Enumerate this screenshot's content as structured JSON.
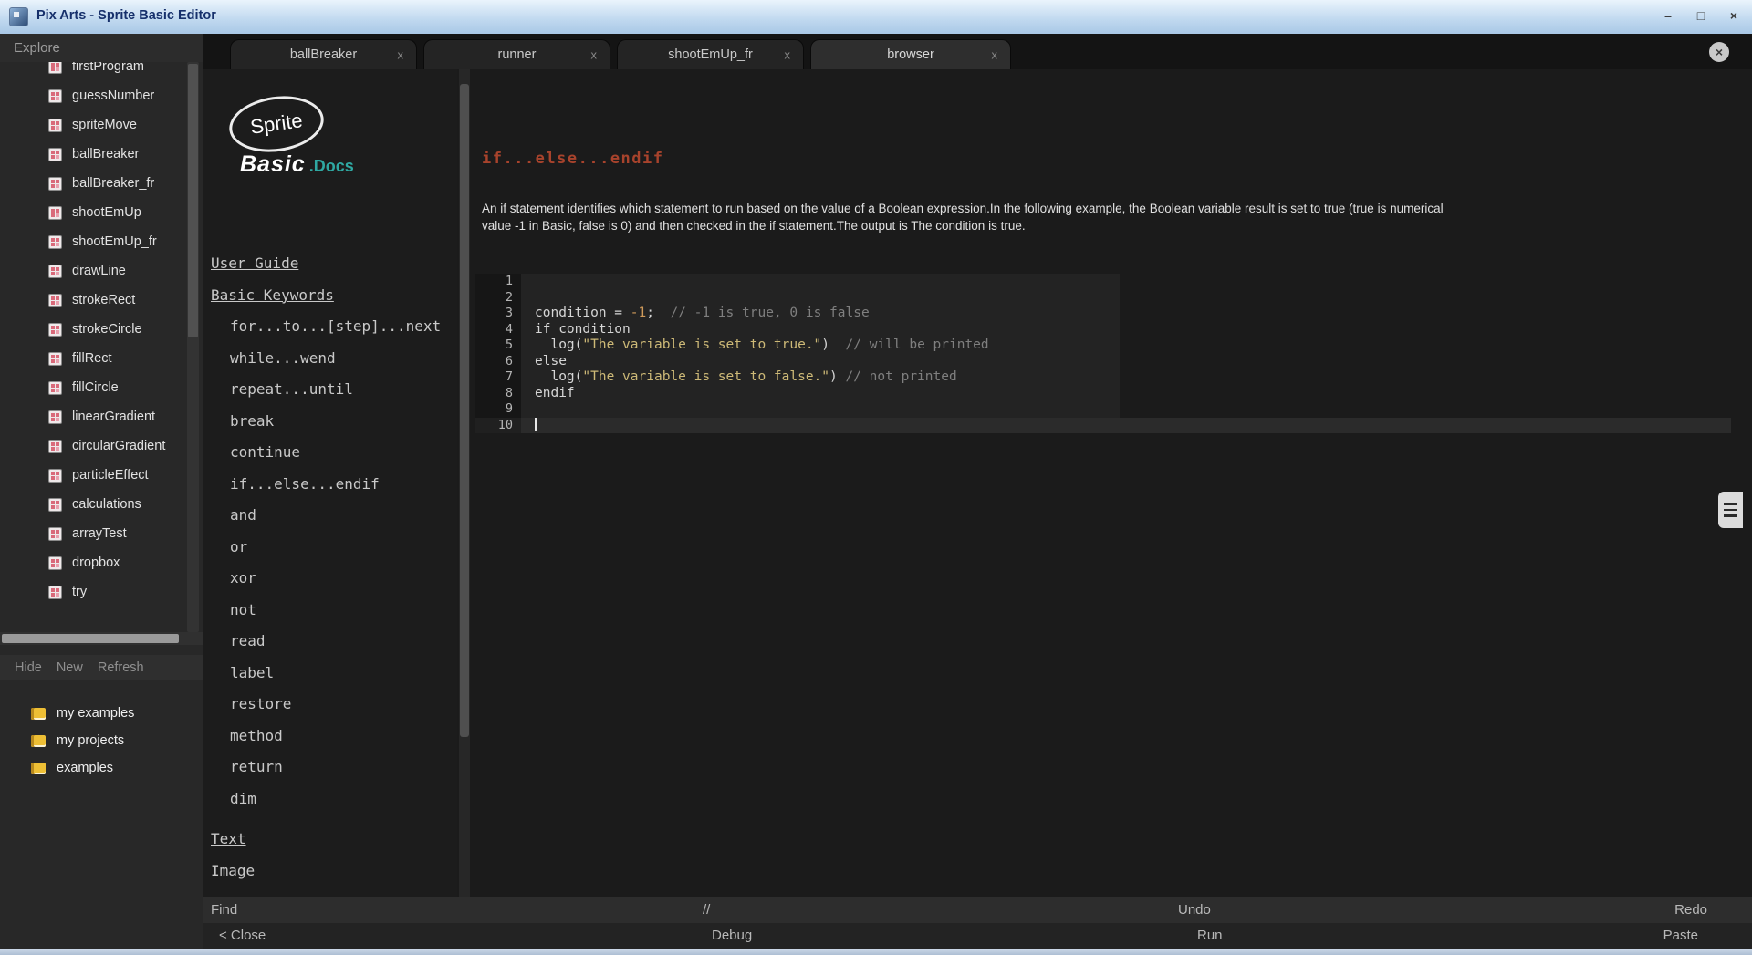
{
  "colors": {
    "accent_teal": "#2fa8a2",
    "doc_title_red": "#a8432c",
    "code_string": "#cdb977",
    "code_number": "#cf9a5a",
    "code_comment": "#7f7f7f",
    "titlebar_text": "#16306b"
  },
  "window": {
    "title": "Pix Arts - Sprite Basic Editor",
    "controls": [
      {
        "name": "minimize",
        "glyph": "–"
      },
      {
        "name": "maximize",
        "glyph": "□"
      },
      {
        "name": "close",
        "glyph": "×"
      }
    ]
  },
  "explorer": {
    "header": "Explore",
    "files": [
      "firstProgram",
      "guessNumber",
      "spriteMove",
      "ballBreaker",
      "ballBreaker_fr",
      "shootEmUp",
      "shootEmUp_fr",
      "drawLine",
      "strokeRect",
      "strokeCircle",
      "fillRect",
      "fillCircle",
      "linearGradient",
      "circularGradient",
      "particleEffect",
      "calculations",
      "arrayTest",
      "dropbox",
      "try"
    ],
    "actions": [
      "Hide",
      "New",
      "Refresh"
    ],
    "folders": [
      "my examples",
      "my projects",
      "examples"
    ]
  },
  "tabs_meta": {
    "close_glyph": "x",
    "close_all_glyph": "×"
  },
  "tabs": [
    {
      "label": "ballBreaker",
      "active": false
    },
    {
      "label": "runner",
      "active": false
    },
    {
      "label": "shootEmUp_fr",
      "active": false
    },
    {
      "label": "browser",
      "active": true
    }
  ],
  "docs_nav": {
    "logo": {
      "sprite": "Sprite",
      "basic": "Basic",
      "docs": ".Docs"
    },
    "items": [
      {
        "label": "User Guide",
        "kind": "section"
      },
      {
        "label": "Basic Keywords",
        "kind": "section"
      },
      {
        "label": "for...to...[step]...next",
        "kind": "item"
      },
      {
        "label": "while...wend",
        "kind": "item"
      },
      {
        "label": "repeat...until",
        "kind": "item"
      },
      {
        "label": "break",
        "kind": "item"
      },
      {
        "label": "continue",
        "kind": "item"
      },
      {
        "label": "if...else...endif",
        "kind": "item"
      },
      {
        "label": "and",
        "kind": "item"
      },
      {
        "label": "or",
        "kind": "item"
      },
      {
        "label": "xor",
        "kind": "item"
      },
      {
        "label": "not",
        "kind": "item"
      },
      {
        "label": "read",
        "kind": "item"
      },
      {
        "label": "label",
        "kind": "item"
      },
      {
        "label": "restore",
        "kind": "item"
      },
      {
        "label": "method",
        "kind": "item"
      },
      {
        "label": "return",
        "kind": "item"
      },
      {
        "label": "dim",
        "kind": "item"
      },
      {
        "label": "Text",
        "kind": "section",
        "gap": true
      },
      {
        "label": "Image",
        "kind": "section"
      }
    ]
  },
  "doc": {
    "title": "if...else...endif",
    "body": "An if statement identifies which statement to run based on the value of a Boolean expression.In the following example, the Boolean variable result is set to true (true is numerical value -1 in Basic, false is 0) and then checked in the if statement.The output is The condition is true.",
    "code_lines": [
      {
        "n": "1",
        "seg": []
      },
      {
        "n": "2",
        "seg": []
      },
      {
        "n": "3",
        "seg": [
          [
            "plain",
            "condition = "
          ],
          [
            "number",
            "-1"
          ],
          [
            "plain",
            ";  "
          ],
          [
            "comment",
            "// -1 is true, 0 is false"
          ]
        ]
      },
      {
        "n": "4",
        "seg": [
          [
            "plain",
            "if condition"
          ]
        ]
      },
      {
        "n": "5",
        "seg": [
          [
            "plain",
            "  log("
          ],
          [
            "string",
            "\"The variable is set to true.\""
          ],
          [
            "plain",
            ")  "
          ],
          [
            "comment",
            "// will be printed"
          ]
        ]
      },
      {
        "n": "6",
        "seg": [
          [
            "plain",
            "else"
          ]
        ]
      },
      {
        "n": "7",
        "seg": [
          [
            "plain",
            "  log("
          ],
          [
            "string",
            "\"The variable is set to false.\""
          ],
          [
            "plain",
            ") "
          ],
          [
            "comment",
            "// not printed"
          ]
        ]
      },
      {
        "n": "8",
        "seg": [
          [
            "plain",
            "endif"
          ]
        ]
      },
      {
        "n": "9",
        "seg": []
      },
      {
        "n": "10",
        "seg": [],
        "cursor": true
      }
    ]
  },
  "statusbar": {
    "find": "Find",
    "comment": "//",
    "undo": "Undo",
    "redo": "Redo"
  },
  "actionbar": {
    "close": "< Close",
    "debug": "Debug",
    "run": "Run",
    "paste": "Paste"
  }
}
